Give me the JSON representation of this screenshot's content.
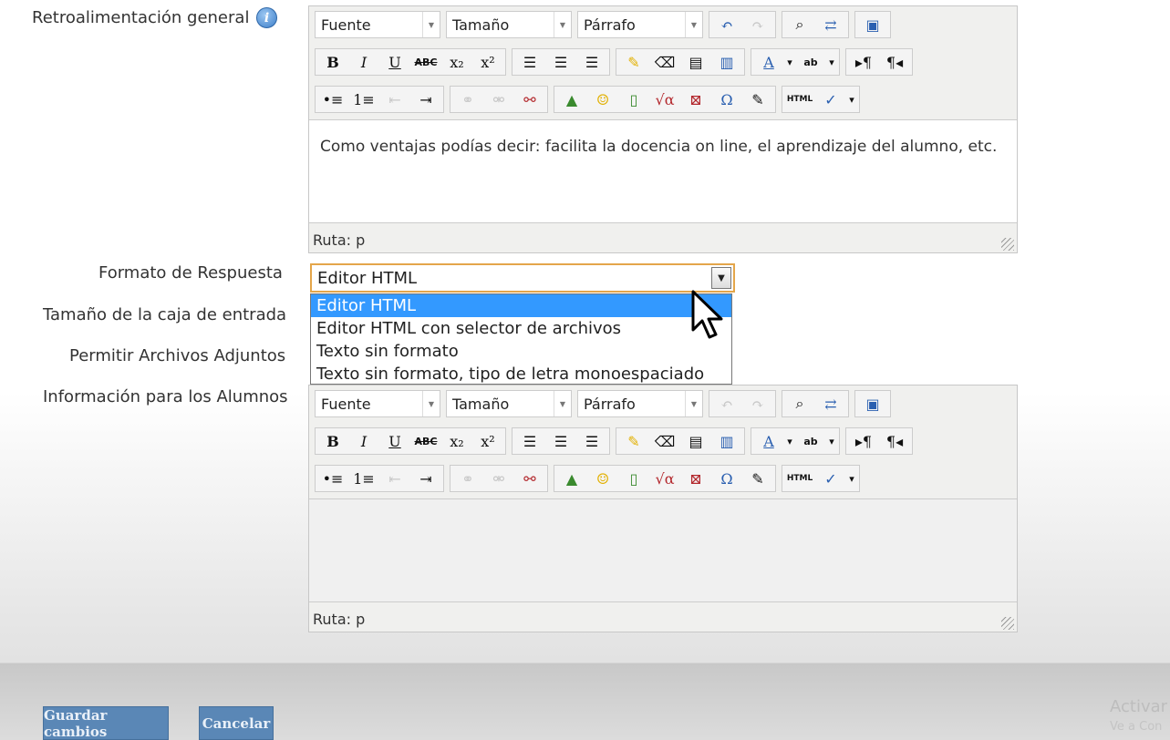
{
  "labels": {
    "feedback": "Retroalimentación general",
    "format": "Formato de Respuesta",
    "box_size": "Tamaño de la caja de entrada",
    "attachments": "Permitir Archivos Adjuntos",
    "student_info": "Información para los Alumnos"
  },
  "info_icon": "i",
  "editor_toolbar": {
    "font": "Fuente",
    "size": "Tamaño",
    "paragraph": "Párrafo",
    "buttons_row2": [
      "B",
      "I",
      "U",
      "ABC",
      "x₂",
      "x²"
    ],
    "special": [
      "Ω",
      "√α",
      "HTML"
    ]
  },
  "feedback_editor": {
    "content": "Como ventajas podías decir: facilita la docencia on line, el aprendizaje del alumno, etc.",
    "path": "Ruta: p"
  },
  "info_editor": {
    "content": "",
    "path": "Ruta: p"
  },
  "format_select": {
    "value": "Editor HTML",
    "options": [
      "Editor HTML",
      "Editor HTML con selector de archivos",
      "Texto sin formato",
      "Texto sin formato, tipo de letra monoespaciado"
    ],
    "highlighted_index": 0
  },
  "buttons": {
    "save": "Guardar cambios",
    "cancel": "Cancelar"
  },
  "watermark": {
    "line1": "Activar",
    "line2": "Ve a Con"
  },
  "colors": {
    "highlight": "#3399ff",
    "select_focus": "#e4a64a",
    "button_bg": "#5a87b6"
  }
}
